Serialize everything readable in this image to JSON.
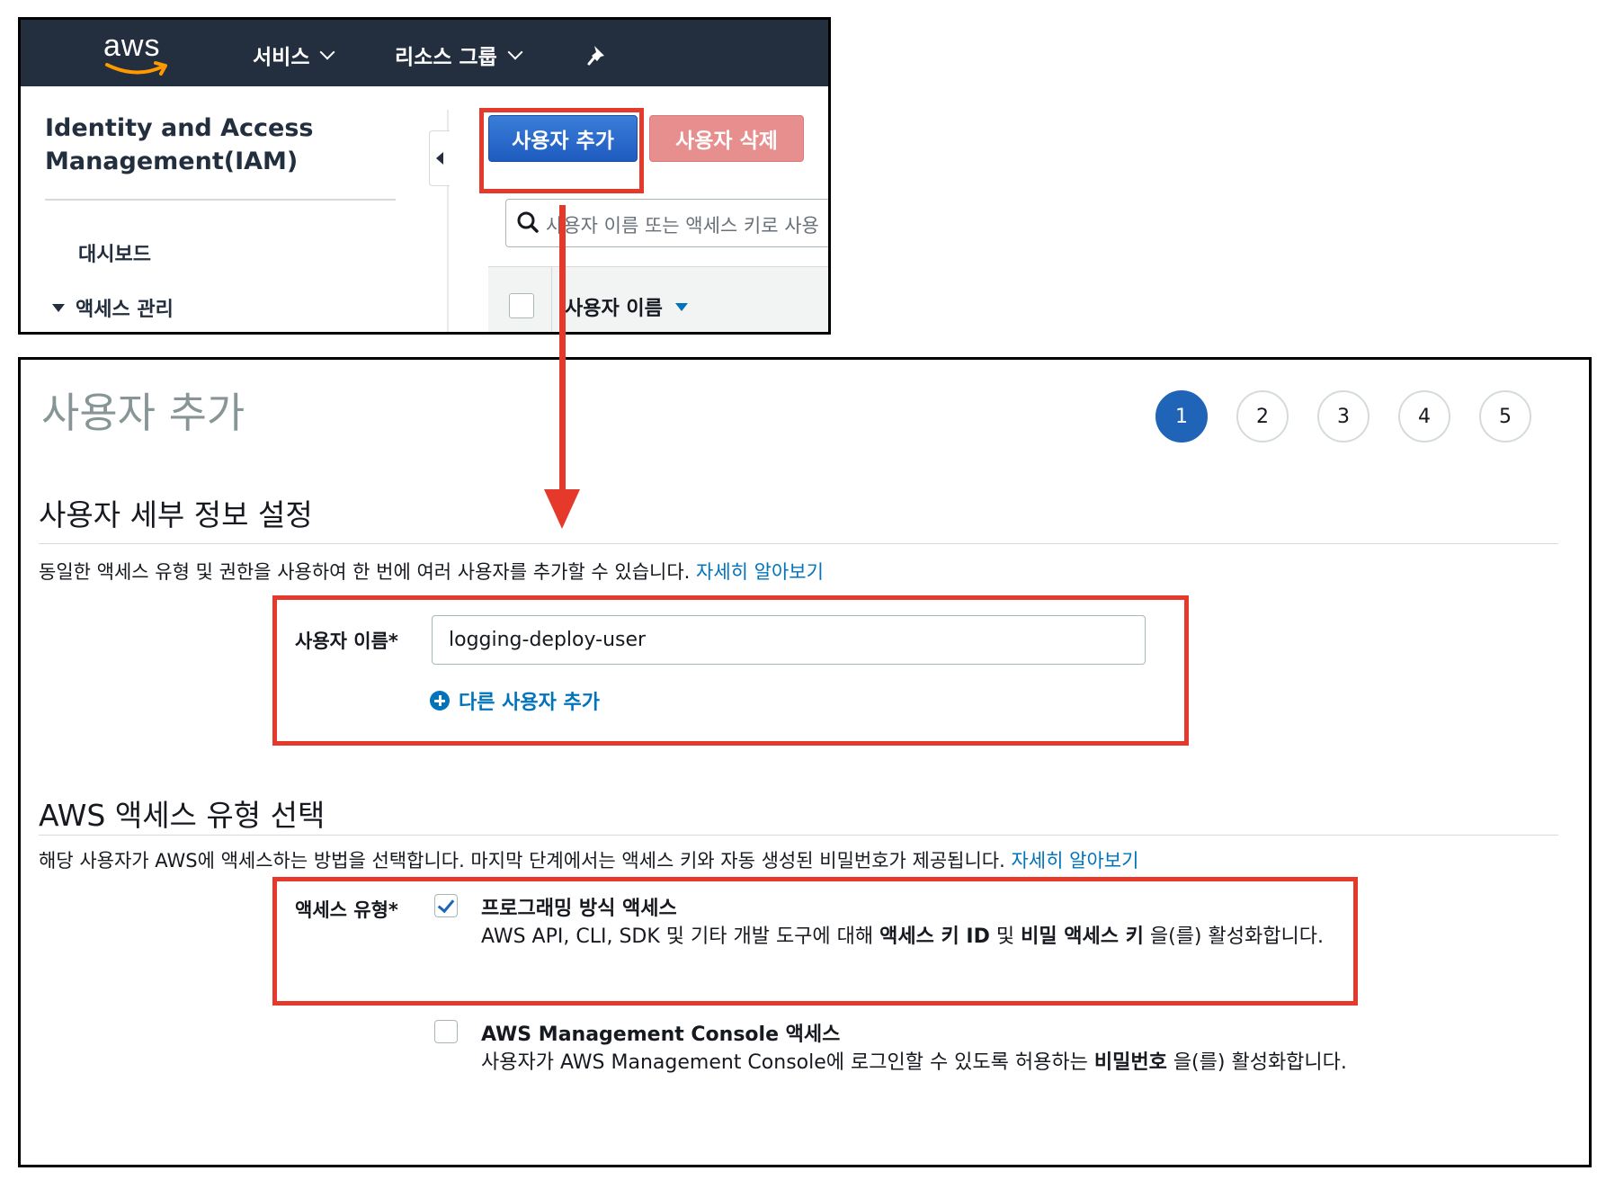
{
  "console": {
    "logo_text": "aws",
    "nav": {
      "services": "서비스",
      "resource_groups": "리소스 그룹"
    },
    "sidebar": {
      "title": "Identity and Access Management(IAM)",
      "dashboard": "대시보드",
      "access_management": "액세스 관리"
    },
    "toolbar": {
      "add_user": "사용자 추가",
      "delete_user": "사용자 삭제"
    },
    "search": {
      "placeholder": "사용자 이름 또는 액세스 키로 사용"
    },
    "table": {
      "column_username": "사용자 이름"
    }
  },
  "wizard": {
    "title": "사용자 추가",
    "steps": [
      "1",
      "2",
      "3",
      "4",
      "5"
    ],
    "active_step": 1,
    "user_details": {
      "heading": "사용자 세부 정보 설정",
      "description": "동일한 액세스 유형 및 권한을 사용하여 한 번에 여러 사용자를 추가할 수 있습니다. ",
      "learn_more": "자세히 알아보기",
      "username_label": "사용자 이름*",
      "username_value": "logging-deploy-user",
      "add_another": "다른 사용자 추가"
    },
    "access_type": {
      "heading": "AWS 액세스 유형 선택",
      "description": "해당 사용자가 AWS에 액세스하는 방법을 선택합니다. 마지막 단계에서는 액세스 키와 자동 생성된 비밀번호가 제공됩니다. ",
      "learn_more": "자세히 알아보기",
      "label": "액세스 유형*",
      "options": [
        {
          "title": "프로그래밍 방식 액세스",
          "checked": true,
          "desc_prefix": "AWS API, CLI, SDK 및 기타 개발 도구에 대해 ",
          "desc_bold1": "액세스 키 ID",
          "desc_mid": " 및 ",
          "desc_bold2": "비밀 액세스 키",
          "desc_suffix": " 을(를) 활성화합니다."
        },
        {
          "title": "AWS Management Console 액세스",
          "checked": false,
          "desc_prefix": "사용자가 AWS Management Console에 로그인할 수 있도록 허용하는 ",
          "desc_bold1": "비밀번호",
          "desc_suffix": " 을(를) 활성화합니다."
        }
      ]
    }
  },
  "colors": {
    "highlight": "#e5392b",
    "primary": "#2064b8",
    "link": "#0073bb",
    "topbar": "#232f3e"
  }
}
